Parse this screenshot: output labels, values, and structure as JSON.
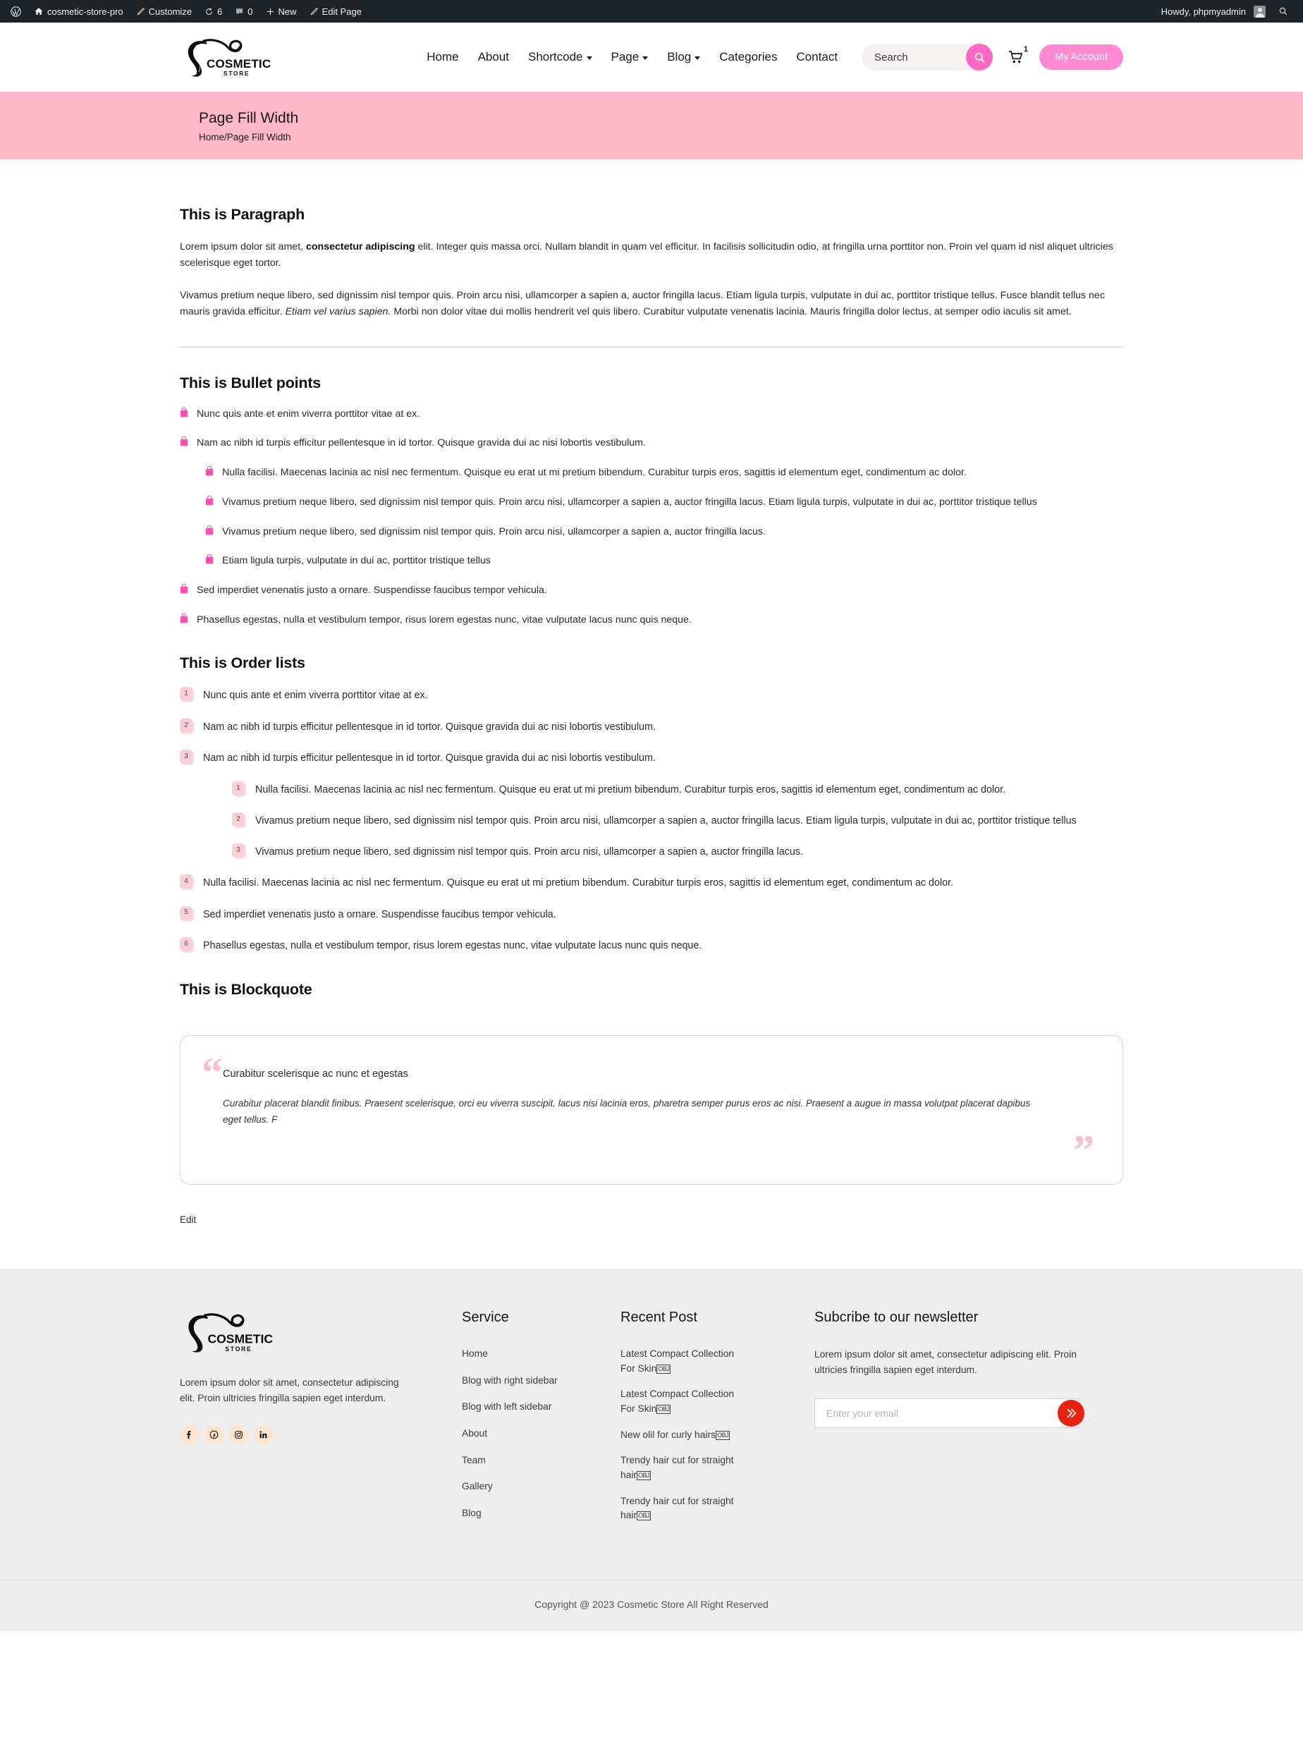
{
  "adminbar": {
    "site_name": "cosmetic-store-pro",
    "customize": "Customize",
    "updates_count": "6",
    "comments_count": "0",
    "new": "New",
    "edit_page": "Edit Page",
    "howdy": "Howdy, phpmyadmin"
  },
  "header": {
    "logo_title": "COSMETIC",
    "logo_sub": "STORE",
    "nav": [
      {
        "label": "Home",
        "has_caret": false
      },
      {
        "label": "About",
        "has_caret": false
      },
      {
        "label": "Shortcode",
        "has_caret": true
      },
      {
        "label": "Page",
        "has_caret": true
      },
      {
        "label": "Blog",
        "has_caret": true
      },
      {
        "label": "Categories",
        "has_caret": false
      },
      {
        "label": "Contact",
        "has_caret": false
      }
    ],
    "search_placeholder": "Search",
    "search_value": "",
    "cart_count": "1",
    "account_label": "My Account",
    "accent_pink": "#ff69c3",
    "account_pink": "#ff8ad1"
  },
  "banner": {
    "title": "Page Fill Width",
    "breadcrumb": "Home/Page Fill Width",
    "bg": "#ffb8ca"
  },
  "content": {
    "paragraph": {
      "heading": "This is Paragraph",
      "p1_a": "Lorem ipsum dolor sit amet, ",
      "p1_bold": "consectetur adipiscing",
      "p1_b": " elit. Integer quis massa orci. Nullam blandit in quam vel efficitur. In facilisis sollicitudin odio, at fringilla urna porttitor non. Proin vel quam id nisl aliquet ultricies scelerisque eget tortor.",
      "p2_a": "Vivamus pretium neque libero, sed dignissim nisl tempor quis. Proin arcu nisi, ullamcorper a sapien a, auctor fringilla lacus. Etiam ligula turpis, vulputate in dui ac, porttitor tristique tellus. Fusce blandit tellus nec mauris gravida efficitur. ",
      "p2_italic": "Etiam vel varius sapien.",
      "p2_b": " Morbi non dolor vitae dui mollis hendrerit vel quis libero. Curabitur vulputate venenatis lacinia. Mauris fringilla dolor lectus, at semper odio iaculis sit amet."
    },
    "bullets": {
      "heading": "This is Bullet points",
      "items": [
        "Nunc quis ante et enim viverra porttitor vitae at ex.",
        "Nam ac nibh id turpis efficitur pellentesque in id tortor. Quisque gravida dui ac nisi lobortis vestibulum.",
        "Sed imperdiet venenatis justo a ornare. Suspendisse faucibus tempor vehicula.",
        "Phasellus egestas, nulla et vestibulum tempor, risus lorem egestas nunc, vitae vulputate lacus nunc quis neque."
      ],
      "nested": [
        "Nulla facilisi. Maecenas lacinia ac nisl nec fermentum. Quisque eu erat ut mi pretium bibendum. Curabitur turpis eros, sagittis id elementum eget, condimentum ac dolor.",
        "Vivamus pretium neque libero, sed dignissim nisl tempor quis. Proin arcu nisi, ullamcorper a sapien a, auctor fringilla lacus. Etiam ligula turpis, vulputate in dui ac, porttitor tristique tellus",
        "Vivamus pretium neque libero, sed dignissim nisl tempor quis. Proin arcu nisi, ullamcorper a sapien a, auctor fringilla lacus.",
        "Etiam ligula turpis, vulputate in dui ac, porttitor tristique tellus"
      ]
    },
    "orders": {
      "heading": "This is Order lists",
      "items": [
        "Nunc quis ante et enim viverra porttitor vitae at ex.",
        "Nam ac nibh id turpis efficitur pellentesque in id tortor. Quisque gravida dui ac nisi lobortis vestibulum.",
        "Nam ac nibh id turpis efficitur pellentesque in id tortor. Quisque gravida dui ac nisi lobortis vestibulum.",
        "Nulla facilisi. Maecenas lacinia ac nisl nec fermentum. Quisque eu erat ut mi pretium bibendum. Curabitur turpis eros, sagittis id elementum eget, condimentum ac dolor.",
        "Sed imperdiet venenatis justo a ornare. Suspendisse faucibus tempor vehicula.",
        "Phasellus egestas, nulla et vestibulum tempor, risus lorem egestas nunc, vitae vulputate lacus nunc quis neque."
      ],
      "numbers": [
        "1",
        "2",
        "3",
        "4",
        "5",
        "6"
      ],
      "nested": [
        "Nulla facilisi. Maecenas lacinia ac nisl nec fermentum. Quisque eu erat ut mi pretium bibendum. Curabitur turpis eros, sagittis id elementum eget, condimentum ac dolor.",
        "Vivamus pretium neque libero, sed dignissim nisl tempor quis. Proin arcu nisi, ullamcorper a sapien a, auctor fringilla lacus. Etiam ligula turpis, vulputate in dui ac, porttitor tristique tellus",
        "Vivamus pretium neque libero, sed dignissim nisl tempor quis. Proin arcu nisi, ullamcorper a sapien a, auctor fringilla lacus."
      ],
      "nested_numbers": [
        "1",
        "2",
        "3"
      ]
    },
    "blockquote": {
      "heading": "This is Blockquote",
      "title": "Curabitur scelerisque ac nunc et egestas",
      "body": "Curabitur placerat blandit finibus. Praesent scelerisque, orci eu viverra suscipit, lacus nisi lacinia eros, pharetra semper purus eros ac nisi. Praesent a augue in massa volutpat placerat dapibus eget tellus. F",
      "open_quote": "“",
      "close_quote": "”",
      "border": "#f3c3cf"
    },
    "edit_label": "Edit"
  },
  "footer": {
    "brand_text": "Lorem ipsum dolor sit amet, consectetur adipiscing elit. Proin ultricies fringilla sapien eget interdum.",
    "socials": [
      "facebook-icon",
      "pinterest-icon",
      "instagram-icon",
      "linkedin-icon"
    ],
    "service": {
      "heading": "Service",
      "links": [
        "Home",
        "Blog with right sidebar",
        "Blog with left sidebar",
        "About",
        "Team",
        "Gallery",
        "Blog"
      ]
    },
    "recent": {
      "heading": "Recent Post",
      "posts": [
        "Latest Compact Collection For Skin",
        "Latest Compact Collection For Skin",
        "New olil for curly hairs",
        "Trendy hair cut for straight hair",
        "Trendy hair cut for straight hair"
      ],
      "missing_glyph": "OBJ"
    },
    "newsletter": {
      "heading": "Subcribe to our newsletter",
      "text": "Lorem ipsum dolor sit amet, consectetur adipiscing elit. Proin ultricies fringilla sapien eget interdum.",
      "placeholder": "Enter your email",
      "value": "",
      "button_color": "#e8220f"
    },
    "copyright": "Copyright @ 2023 Cosmetic Store All Right Reserved",
    "bg": "#eeeeee"
  }
}
